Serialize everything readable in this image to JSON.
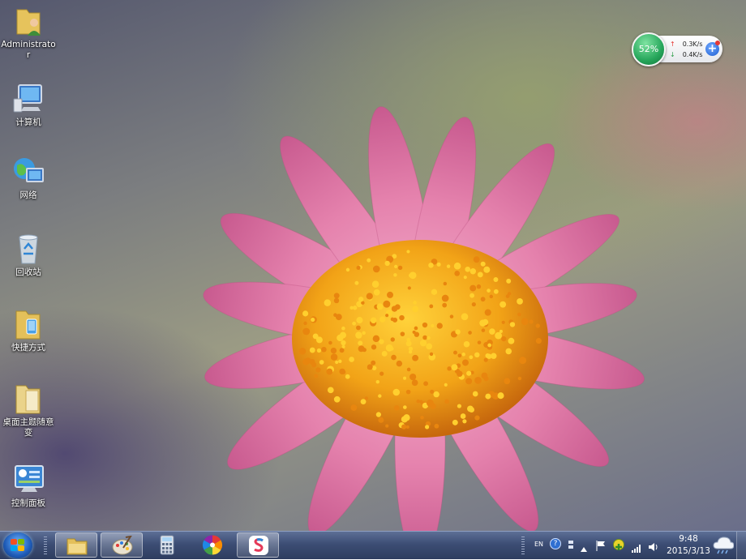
{
  "desktop_icons": [
    {
      "label": "Administrator",
      "icon": "user-folder-icon"
    },
    {
      "label": "计算机",
      "icon": "computer-icon"
    },
    {
      "label": "网络",
      "icon": "network-icon"
    },
    {
      "label": "回收站",
      "icon": "recycle-bin-icon"
    },
    {
      "label": "快捷方式",
      "icon": "folder-icon"
    },
    {
      "label": "桌面主题随意变",
      "icon": "folder-icon"
    },
    {
      "label": "控制面板",
      "icon": "control-panel-icon"
    }
  ],
  "net_widget": {
    "percent": "52%",
    "upload": "0.3K/s",
    "download": "0.4K/s",
    "up_arrow": "↑",
    "down_arrow": "↓",
    "plus": "+"
  },
  "taskbar": {
    "pinned": [
      {
        "name": "file-explorer-icon",
        "active": true
      },
      {
        "name": "paint-palette-icon",
        "active": true
      },
      {
        "name": "calculator-icon",
        "active": false
      },
      {
        "name": "color-wheel-icon",
        "active": false
      },
      {
        "name": "app-s-icon",
        "active": true
      }
    ]
  },
  "tray": {
    "lang": "EN",
    "help": "?",
    "clock_time": "9:48",
    "clock_date": "2015/3/13"
  },
  "colors": {
    "taskbar": "#3c4d74",
    "widget_green": "#26a65b",
    "flower_petal": "#e07aa3",
    "flower_center": "#f0a21c"
  }
}
